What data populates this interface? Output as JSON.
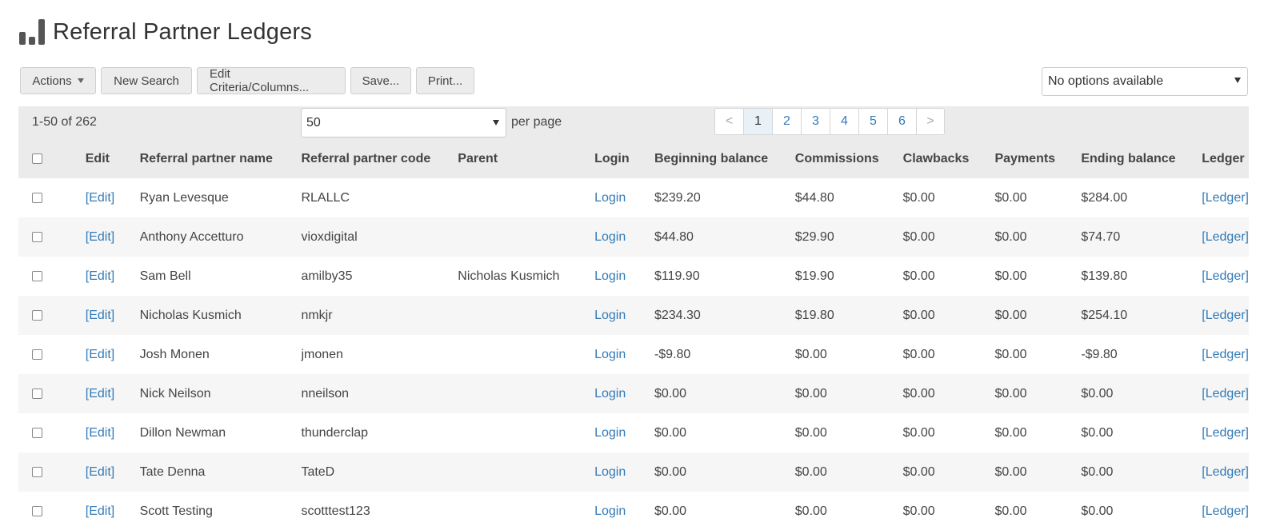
{
  "header": {
    "title": "Referral Partner Ledgers",
    "icon": "bar-chart-icon"
  },
  "toolbar": {
    "actions_label": "Actions",
    "new_search_label": "New Search",
    "edit_criteria_label": "Edit Criteria/Columns...",
    "save_label": "Save...",
    "print_label": "Print...",
    "saved_search_value": "No options available"
  },
  "pagination": {
    "range": "1-50 of 262",
    "per_page_value": "50",
    "per_page_label": "per page",
    "prev": "<",
    "next": ">",
    "pages": [
      "1",
      "2",
      "3",
      "4",
      "5",
      "6"
    ],
    "current_page": "1"
  },
  "table": {
    "columns": {
      "edit": "Edit",
      "name": "Referral partner name",
      "code": "Referral partner code",
      "parent": "Parent",
      "login": "Login",
      "beginning": "Beginning balance",
      "commissions": "Commissions",
      "clawbacks": "Clawbacks",
      "payments": "Payments",
      "ending": "Ending balance",
      "ledger": "Ledger"
    },
    "rows": [
      {
        "edit": "[Edit]",
        "name": "Ryan Levesque",
        "code": "RLALLC",
        "parent": "",
        "login": "Login",
        "beginning": "$239.20",
        "commissions": "$44.80",
        "clawbacks": "$0.00",
        "payments": "$0.00",
        "ending": "$284.00",
        "ledger": "[Ledger]"
      },
      {
        "edit": "[Edit]",
        "name": "Anthony Accetturo",
        "code": "vioxdigital",
        "parent": "",
        "login": "Login",
        "beginning": "$44.80",
        "commissions": "$29.90",
        "clawbacks": "$0.00",
        "payments": "$0.00",
        "ending": "$74.70",
        "ledger": "[Ledger]"
      },
      {
        "edit": "[Edit]",
        "name": "Sam Bell",
        "code": "amilby35",
        "parent": "Nicholas Kusmich",
        "login": "Login",
        "beginning": "$119.90",
        "commissions": "$19.90",
        "clawbacks": "$0.00",
        "payments": "$0.00",
        "ending": "$139.80",
        "ledger": "[Ledger]"
      },
      {
        "edit": "[Edit]",
        "name": "Nicholas Kusmich",
        "code": "nmkjr",
        "parent": "",
        "login": "Login",
        "beginning": "$234.30",
        "commissions": "$19.80",
        "clawbacks": "$0.00",
        "payments": "$0.00",
        "ending": "$254.10",
        "ledger": "[Ledger]"
      },
      {
        "edit": "[Edit]",
        "name": "Josh Monen",
        "code": "jmonen",
        "parent": "",
        "login": "Login",
        "beginning": "-$9.80",
        "commissions": "$0.00",
        "clawbacks": "$0.00",
        "payments": "$0.00",
        "ending": "-$9.80",
        "ledger": "[Ledger]"
      },
      {
        "edit": "[Edit]",
        "name": "Nick Neilson",
        "code": "nneilson",
        "parent": "",
        "login": "Login",
        "beginning": "$0.00",
        "commissions": "$0.00",
        "clawbacks": "$0.00",
        "payments": "$0.00",
        "ending": "$0.00",
        "ledger": "[Ledger]"
      },
      {
        "edit": "[Edit]",
        "name": "Dillon Newman",
        "code": "thunderclap",
        "parent": "",
        "login": "Login",
        "beginning": "$0.00",
        "commissions": "$0.00",
        "clawbacks": "$0.00",
        "payments": "$0.00",
        "ending": "$0.00",
        "ledger": "[Ledger]"
      },
      {
        "edit": "[Edit]",
        "name": "Tate Denna",
        "code": "TateD",
        "parent": "",
        "login": "Login",
        "beginning": "$0.00",
        "commissions": "$0.00",
        "clawbacks": "$0.00",
        "payments": "$0.00",
        "ending": "$0.00",
        "ledger": "[Ledger]"
      },
      {
        "edit": "[Edit]",
        "name": "Scott Testing",
        "code": "scotttest123",
        "parent": "",
        "login": "Login",
        "beginning": "$0.00",
        "commissions": "$0.00",
        "clawbacks": "$0.00",
        "payments": "$0.00",
        "ending": "$0.00",
        "ledger": "[Ledger]"
      }
    ]
  },
  "colors": {
    "link": "#337ab7",
    "header_bg": "#ebebeb",
    "stripe": "#f6f6f6"
  }
}
